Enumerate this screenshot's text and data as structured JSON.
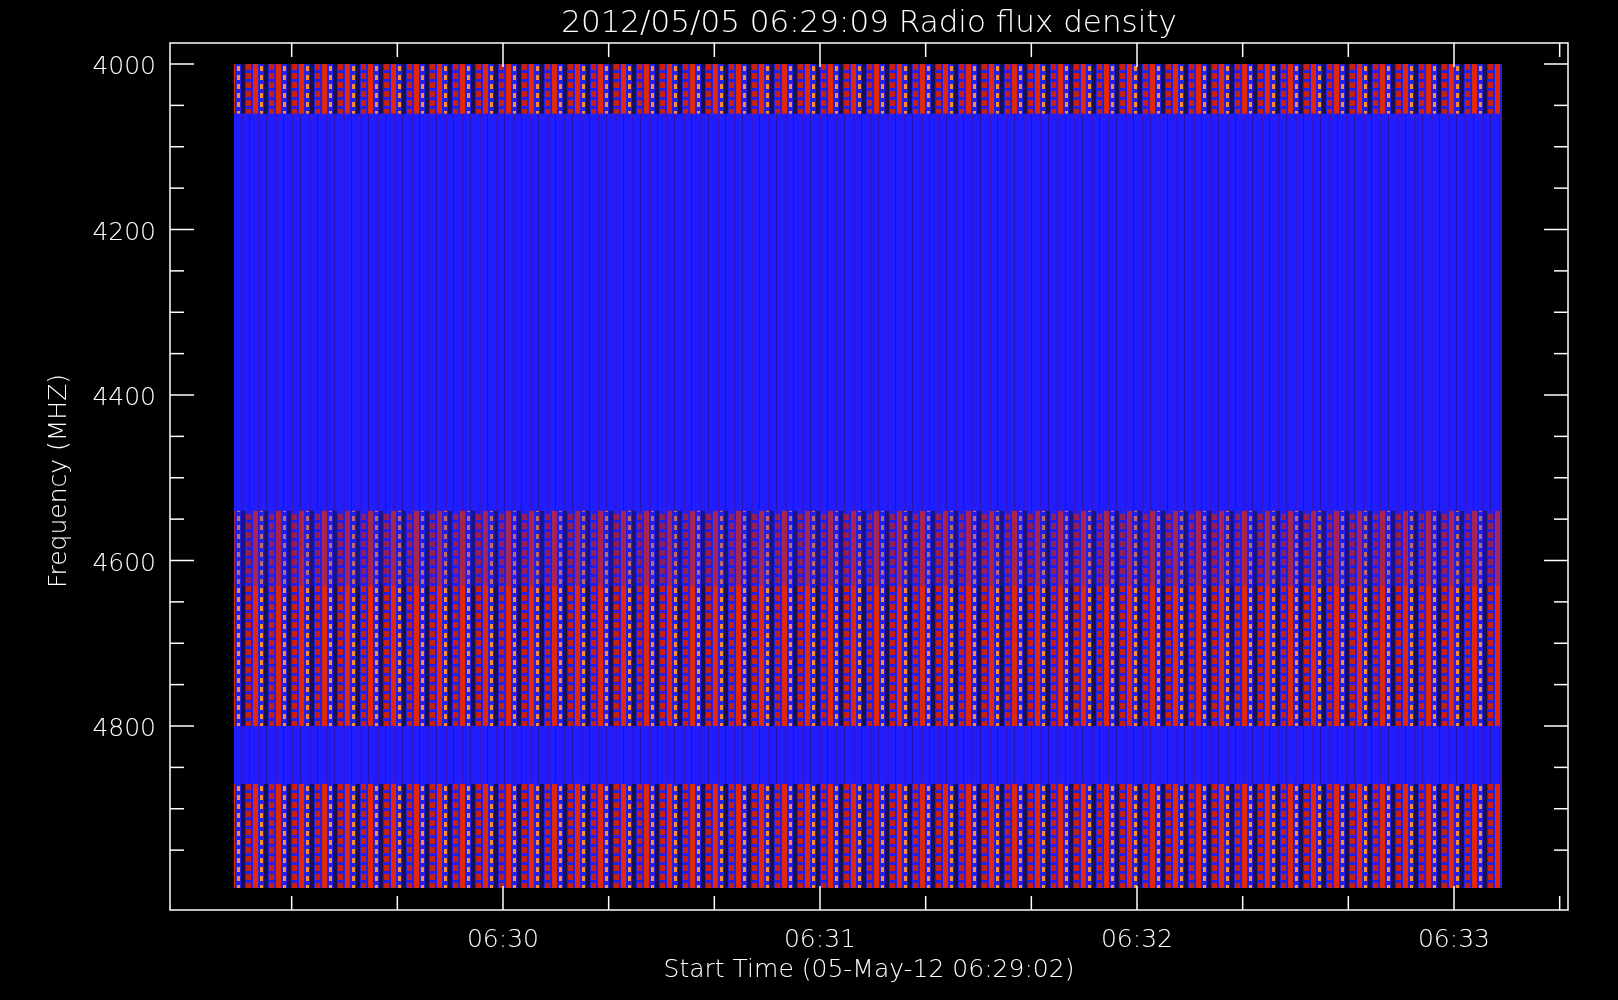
{
  "title": "2012/05/05 06:29:09 Radio flux density",
  "y_axis": {
    "label": "Frequency (MHZ)",
    "ticks": [
      "4000",
      "4200",
      "4400",
      "4600",
      "4800"
    ]
  },
  "x_axis": {
    "label": "Start Time (05-May-12 06:29:02)",
    "ticks": [
      "06:30",
      "06:31",
      "06:32",
      "06:33"
    ]
  }
}
